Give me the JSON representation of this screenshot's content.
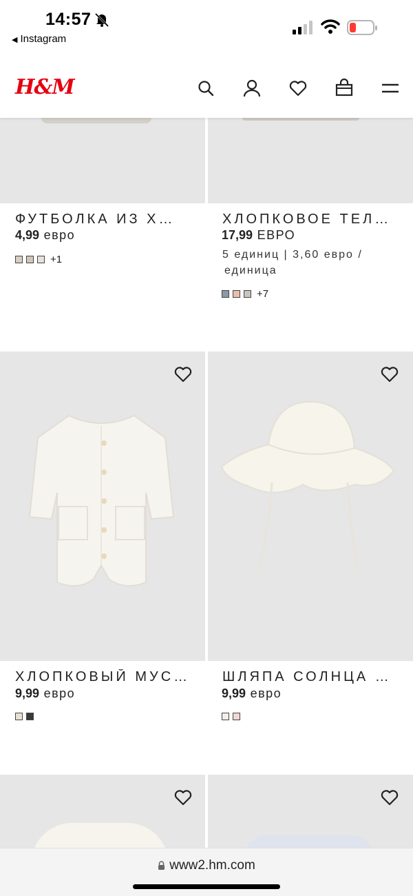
{
  "status": {
    "time": "14:57",
    "back_app": "Instagram"
  },
  "header": {
    "logo": "H&M",
    "icons": [
      "search-icon",
      "account-icon",
      "heart-icon",
      "bag-icon",
      "menu-icon"
    ]
  },
  "products": [
    {
      "title": "ФУТБОЛКА ИЗ Х…",
      "price_num": "4,99",
      "price_cur": "евро",
      "swatches": [
        "#d8cfc4",
        "#cfc7bd",
        "#e6e2da"
      ],
      "more": "+1"
    },
    {
      "title": "ХЛОПКОВОЕ ТЕЛ…",
      "price_num": "17,99",
      "price_cur": "ЕВРО",
      "unit_line1": "5 единиц | 3,60 евро /",
      "unit_line2": "единица",
      "swatches": [
        "#8d98a8",
        "#e8bfae",
        "#c9c4be"
      ],
      "more": "+7"
    },
    {
      "title": "ХЛОПКОВЫЙ МУС…",
      "price_num": "9,99",
      "price_cur": "евро",
      "swatches": [
        "#e8e0d2",
        "#3a3a3a"
      ]
    },
    {
      "title": "ШЛЯПА СОЛНЦА …",
      "price_num": "9,99",
      "price_cur": "евро",
      "swatches": [
        "#f2efe8",
        "#f0d8d4"
      ]
    }
  ],
  "browser": {
    "url": "www2.hm.com"
  },
  "colors": {
    "brand": "#e50010",
    "image_bg": "#e6e6e6"
  }
}
